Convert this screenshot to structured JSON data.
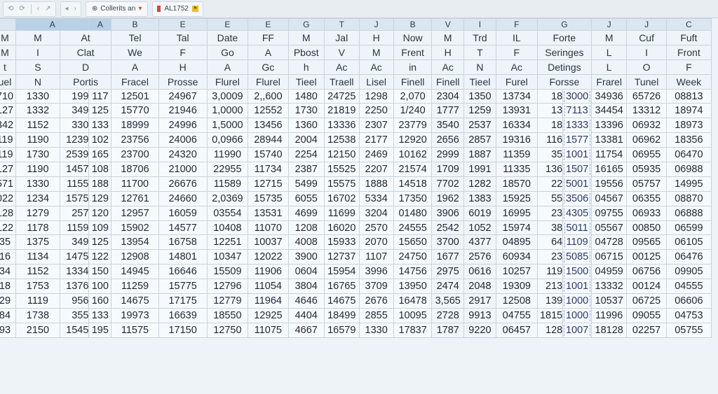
{
  "toolbar": {
    "nav_back": "‹",
    "nav_fwd": "›",
    "title": "Collerits an",
    "cell_ref": "AL1752"
  },
  "column_letters": [
    "A",
    "A",
    "B",
    "E",
    "E",
    "E",
    "G",
    "T",
    "J",
    "B",
    "V",
    "I",
    "F",
    "G",
    "J",
    "J",
    "C"
  ],
  "header_rows": [
    [
      "M",
      "M",
      "At",
      "Tel",
      "Tal",
      "Date",
      "FF",
      "M",
      "Jal",
      "H",
      "Now",
      "M",
      "Trd",
      "IL",
      "Forte",
      "M",
      "Cuf",
      "Fuft"
    ],
    [
      "M",
      "I",
      "Clat",
      "We",
      "F",
      "Go",
      "A",
      "Pbost",
      "V",
      "M",
      "Frent",
      "H",
      "T",
      "F",
      "Seringes",
      "L",
      "I",
      "Front"
    ],
    [
      "t",
      "S",
      "D",
      "A",
      "H",
      "A",
      "Gc",
      "h",
      "Ac",
      "Ac",
      "in",
      "Ac",
      "N",
      "Ac",
      "Detings",
      "L",
      "O",
      "F"
    ],
    [
      "uel",
      "N",
      "Portis",
      "Fracel",
      "Prosse",
      "Flurel",
      "Flurel",
      "Tieel",
      "Traell",
      "Lisel",
      "Finell",
      "Finell",
      "Tieel",
      "Furel",
      "Forsse",
      "Frarel",
      "Tunel",
      "Week"
    ]
  ],
  "rows": [
    [
      "710",
      "1330",
      "199",
      "117",
      "12501",
      "24967",
      "3,0009",
      "2,,600",
      "1480",
      "24725",
      "1298",
      "2,070",
      "2304",
      "1350",
      "13734",
      "18",
      "3000",
      "34936",
      "65726",
      "08813"
    ],
    [
      "127",
      "1332",
      "349",
      "125",
      "15770",
      "21946",
      "1,0000",
      "12552",
      "1730",
      "21819",
      "2250",
      "1/240",
      "1777",
      "1259",
      "13931",
      "13",
      "7113",
      "34454",
      "13312",
      "18974"
    ],
    [
      "342",
      "1152",
      "330",
      "133",
      "18999",
      "24996",
      "1,5000",
      "13456",
      "1360",
      "13336",
      "2307",
      "23779",
      "3540",
      "2537",
      "16334",
      "18",
      "1333",
      "13396",
      "06932",
      "18973"
    ],
    [
      "119",
      "1190",
      "1239",
      "102",
      "23756",
      "24006",
      "0,0966",
      "28944",
      "2004",
      "12538",
      "2177",
      "12920",
      "2656",
      "2857",
      "19316",
      "116",
      "1577",
      "13381",
      "06962",
      "18356"
    ],
    [
      "119",
      "1730",
      "2539",
      "165",
      "23700",
      "24320",
      "11990",
      "15740",
      "2254",
      "12150",
      "2469",
      "10162",
      "2999",
      "1887",
      "11359",
      "35",
      "1001",
      "11754",
      "06955",
      "06470"
    ],
    [
      "127",
      "1190",
      "1457",
      "108",
      "18706",
      "21000",
      "22955",
      "11734",
      "2387",
      "15525",
      "2207",
      "21574",
      "1709",
      "1991",
      "11335",
      "136",
      "1507",
      "16165",
      "05935",
      "06988"
    ],
    [
      "571",
      "1330",
      "1155",
      "188",
      "11700",
      "26676",
      "11589",
      "12715",
      "5499",
      "15575",
      "1888",
      "14518",
      "7702",
      "1282",
      "18570",
      "22",
      "5001",
      "19556",
      "05757",
      "14995"
    ],
    [
      "022",
      "1234",
      "1575",
      "129",
      "12761",
      "24660",
      "2,0369",
      "15735",
      "6055",
      "16702",
      "5334",
      "17350",
      "1962",
      "1383",
      "15925",
      "55",
      "3506",
      "04567",
      "06355",
      "08870"
    ],
    [
      "128",
      "1279",
      "257",
      "120",
      "12957",
      "16059",
      "03554",
      "13531",
      "4699",
      "11699",
      "3204",
      "01480",
      "3906",
      "6019",
      "16995",
      "23",
      "4305",
      "09755",
      "06933",
      "06888"
    ],
    [
      "122",
      "1178",
      "1159",
      "109",
      "15902",
      "14577",
      "10408",
      "11070",
      "1208",
      "16020",
      "2570",
      "24555",
      "2542",
      "1052",
      "15974",
      "38",
      "5011",
      "05567",
      "00850",
      "06599"
    ],
    [
      "35",
      "1375",
      "349",
      "125",
      "13954",
      "16758",
      "12251",
      "10037",
      "4008",
      "15933",
      "2070",
      "15650",
      "3700",
      "4377",
      "04895",
      "64",
      "1109",
      "04728",
      "09565",
      "06105"
    ],
    [
      "16",
      "1134",
      "1475",
      "122",
      "12908",
      "14801",
      "10347",
      "12022",
      "3900",
      "12737",
      "1107",
      "24750",
      "1677",
      "2576",
      "60934",
      "23",
      "5085",
      "06715",
      "00125",
      "06476"
    ],
    [
      "34",
      "1152",
      "1334",
      "150",
      "14945",
      "16646",
      "15509",
      "11906",
      "0604",
      "15954",
      "3996",
      "14756",
      "2975",
      "0616",
      "10257",
      "119",
      "1500",
      "04959",
      "06756",
      "09905"
    ],
    [
      "18",
      "1753",
      "1376",
      "100",
      "11259",
      "15775",
      "12796",
      "11054",
      "3804",
      "16765",
      "3709",
      "13950",
      "2474",
      "2048",
      "19309",
      "213",
      "1001",
      "13332",
      "00124",
      "04555"
    ],
    [
      "29",
      "1119",
      "956",
      "160",
      "14675",
      "17175",
      "12779",
      "11964",
      "4646",
      "14675",
      "2676",
      "16478",
      "3,565",
      "2917",
      "12508",
      "139",
      "1000",
      "10537",
      "06725",
      "06606"
    ],
    [
      "84",
      "1738",
      "355",
      "133",
      "19973",
      "16639",
      "18550",
      "12925",
      "4404",
      "18499",
      "2855",
      "10095",
      "2728",
      "9913",
      "04755",
      "1815",
      "1000",
      "11996",
      "09055",
      "04753"
    ],
    [
      "93",
      "2150",
      "1545",
      "195",
      "11575",
      "17150",
      "12750",
      "11075",
      "4667",
      "16579",
      "1330",
      "17837",
      "1787",
      "9220",
      "06457",
      "128",
      "1007",
      "18128",
      "02257",
      "05755"
    ]
  ]
}
